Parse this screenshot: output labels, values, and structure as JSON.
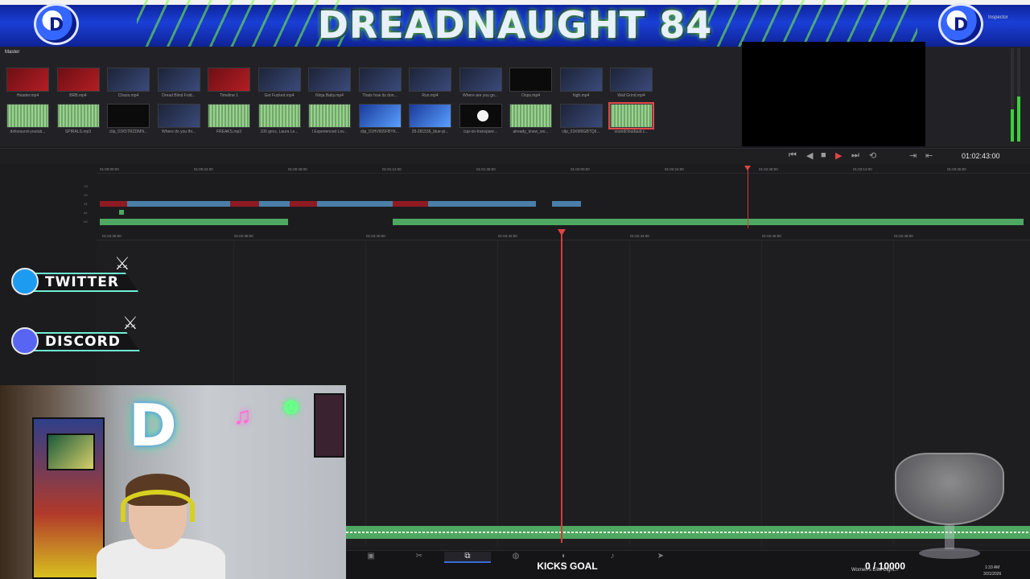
{
  "banner": {
    "title": "DREADNAUGHT 84",
    "logo_letter": "D"
  },
  "media_pool": {
    "folder": "Master",
    "clips": [
      {
        "name": "Header.mp4",
        "thumb": "red"
      },
      {
        "name": "BRB.mp4",
        "thumb": "red"
      },
      {
        "name": "Chaos.mp4",
        "thumb": "dark"
      },
      {
        "name": "Dread Blind Fold...",
        "thumb": "dark"
      },
      {
        "name": "Timeline 1",
        "thumb": "red"
      },
      {
        "name": "Get Fucked.mp4",
        "thumb": "dark"
      },
      {
        "name": "Ninja Baby.mp4",
        "thumb": "dark"
      },
      {
        "name": "Thats how its don...",
        "thumb": "dark"
      },
      {
        "name": "Run.mp4",
        "thumb": "dark"
      },
      {
        "name": "Where are you go...",
        "thumb": "dark"
      },
      {
        "name": "Oops.mp4",
        "thumb": "black"
      },
      {
        "name": "high.mp4",
        "thumb": "dark"
      },
      {
        "name": "Wall Grind.mp4",
        "thumb": "dark"
      },
      {
        "name": "dxfosound-youtub...",
        "thumb": "green"
      },
      {
        "name": "SPIRALS.mp3",
        "thumb": "green"
      },
      {
        "name": "clip_01K5TRZDMN...",
        "thumb": "black"
      },
      {
        "name": "Where do you thi...",
        "thumb": "dark"
      },
      {
        "name": "FREAKS.mp3",
        "thumb": "green"
      },
      {
        "name": "100 gecs, Laura Le...",
        "thumb": "green"
      },
      {
        "name": "I Experienced Lov...",
        "thumb": "green"
      },
      {
        "name": "clip_01HV605FBYK...",
        "thumb": "blue"
      },
      {
        "name": "28-281536_blue-pi...",
        "thumb": "blue"
      },
      {
        "name": "cup-on-transpare...",
        "thumb": "white"
      },
      {
        "name": "already_knew_wo...",
        "thumb": "green"
      },
      {
        "name": "clip_01KM9GBTQ6...",
        "thumb": "dark"
      },
      {
        "name": "soundcloudaud.c...",
        "thumb": "green"
      }
    ]
  },
  "inspector_label": "Inspector",
  "transport": {
    "timecode": "01:02:43:00",
    "icons": [
      "skip-start-icon",
      "step-back-icon",
      "stop-icon",
      "play-icon",
      "step-forward-icon",
      "loop-icon"
    ]
  },
  "upper_ruler": [
    "01:00:00:00",
    "01:00:24:00",
    "01:00:48:00",
    "01:01:12:00",
    "01:01:36:00",
    "01:02:00:00",
    "01:02:24:00",
    "01:02:48:00",
    "01:03:12:00",
    "01:03:36:00"
  ],
  "lower_ruler": [
    "01:02:36:00",
    "01:02:38:00",
    "01:02:40:00",
    "01:02:42:00",
    "01:02:44:00",
    "01:02:46:00",
    "01:02:48:00"
  ],
  "track_labels": [
    "V3",
    "V2",
    "V1",
    "A1",
    "A2"
  ],
  "overlay": {
    "twitter": "TWITTER",
    "discord": "DISCORD"
  },
  "stream": {
    "goal_label": "KICKS GOAL",
    "goal_count": "0 / 10000",
    "ticker": "Women's Elite Eight..."
  },
  "clock": {
    "time": "1:33 AM",
    "date": "3/31/2026"
  },
  "pages": [
    "media-page-icon",
    "cut-page-icon",
    "edit-page-icon",
    "fusion-page-icon",
    "color-page-icon",
    "fairlight-page-icon",
    "deliver-page-icon"
  ],
  "colors": {
    "accent": "#3a6ad8",
    "playhead": "#d83a3a",
    "audio": "#4ea861",
    "video": "#4a7fa8",
    "banner": "#1a3fd6"
  }
}
